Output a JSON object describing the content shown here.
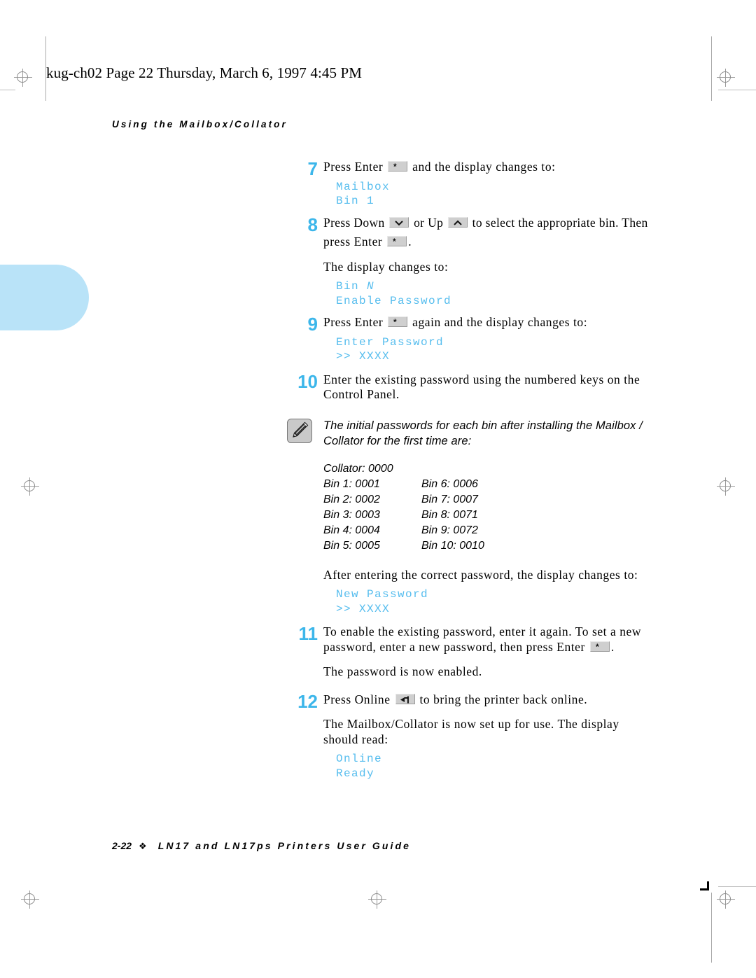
{
  "page": {
    "filestamp": "kug-ch02  Page 22  Thursday, March 6, 1997  4:45 PM",
    "running_head": "Using the Mailbox/Collator",
    "footer_page": "2-22",
    "footer_diamond": "❖",
    "footer_title": "LN17 and LN17ps Printers User Guide",
    "accent_blue": "#3cb6ea",
    "display_blue": "#56bdee",
    "tab_blue": "#b9e3f8"
  },
  "steps": [
    {
      "number": "7",
      "text_before": "Press Enter",
      "key": "enter-key",
      "text_after": "and the display changes to:",
      "display": "Mailbox\nBin 1"
    },
    {
      "number": "8",
      "line1_a": "Press Down",
      "key1": "down-key",
      "line1_b": "or Up",
      "key2": "up-key",
      "line1_c": "to select the appropriate bin. Then",
      "line2_a": "press Enter",
      "key3": "enter-key",
      "line2_b": ".",
      "sub_text": "The display changes to:",
      "display_line1_prefix": "Bin ",
      "display_line1_italic": "N",
      "display_line2": "Enable Password"
    },
    {
      "number": "9",
      "text_before": "Press Enter",
      "key": "enter-key",
      "text_after": "again and the display changes to:",
      "display": "Enter Password\n>> XXXX"
    },
    {
      "number": "10",
      "line1": "Enter the existing password using the numbered keys on the",
      "line2": "Control Panel."
    },
    {
      "number": "11",
      "line1": "To enable the existing password, enter it again. To set a new",
      "line2_a": "password, enter a new password, then press Enter",
      "key": "enter-key",
      "line2_b": ".",
      "sub_text": "The password is now enabled."
    },
    {
      "number": "12",
      "text_before": "Press Online",
      "key": "online-key",
      "text_after": "to bring the printer back online.",
      "sub_line1": "The Mailbox/Collator is now set up for use. The display",
      "sub_line2": "should read:",
      "display": "Online\nReady"
    }
  ],
  "note": {
    "icon": "pencil-icon",
    "line1": "The initial passwords for each bin after installing the Mailbox /",
    "line2": "Collator for the first time are:"
  },
  "password_table": {
    "collator": "Collator: 0000",
    "rows": [
      {
        "left": "Bin 1: 0001",
        "right": "Bin 6: 0006"
      },
      {
        "left": "Bin 2: 0002",
        "right": "Bin 7: 0007"
      },
      {
        "left": "Bin 3: 0003",
        "right": "Bin 8: 0071"
      },
      {
        "left": "Bin 4: 0004",
        "right": "Bin 9: 0072"
      },
      {
        "left": "Bin 5: 0005",
        "right": "Bin 10: 0010"
      }
    ]
  },
  "after_password": {
    "text": "After entering the correct password, the display changes to:",
    "display": "New Password\n>> XXXX"
  }
}
